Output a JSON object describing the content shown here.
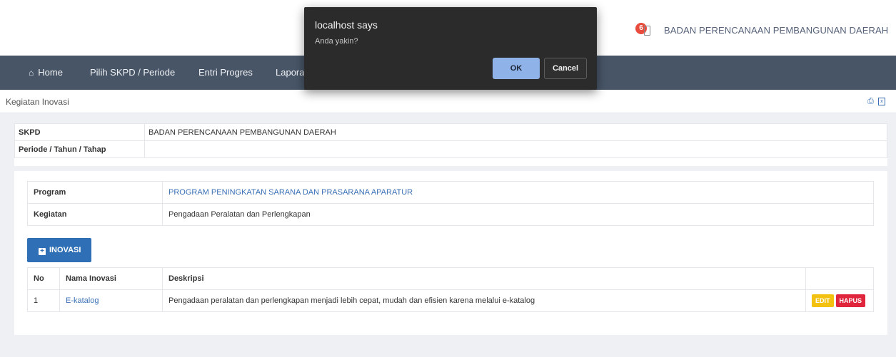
{
  "header": {
    "notification_count": "6",
    "org_name": "BADAN PERENCANAAN PEMBANGUNAN DAERAH"
  },
  "nav": {
    "home": "Home",
    "pilih": "Pilih SKPD / Periode",
    "entri": "Entri Progres",
    "laporan": "Lapora"
  },
  "subheader": {
    "title": "Kegiatan Inovasi"
  },
  "info": {
    "skpd_label": "SKPD",
    "skpd_value": "BADAN PERENCANAAN PEMBANGUNAN DAERAH",
    "periode_label": "Periode / Tahun / Tahap",
    "periode_value": ""
  },
  "program": {
    "program_label": "Program",
    "program_value": "PROGRAM PENINGKATAN SARANA DAN PRASARANA APARATUR",
    "kegiatan_label": "Kegiatan",
    "kegiatan_value": "Pengadaan Peralatan dan Perlengkapan"
  },
  "add_button": {
    "label": "INOVASI"
  },
  "table": {
    "headers": [
      "No",
      "Nama Inovasi",
      "Deskripsi",
      ""
    ],
    "rows": [
      {
        "no": "1",
        "nama": "E-katalog",
        "deskripsi": "Pengadaan peralatan dan perlengkapan menjadi lebih cepat, mudah dan efisien karena melalui e-katalog",
        "edit": "EDIT",
        "hapus": "HAPUS"
      }
    ]
  },
  "dialog": {
    "title": "localhost says",
    "message": "Anda yakin?",
    "ok": "OK",
    "cancel": "Cancel"
  },
  "colors": {
    "navbar": "#475567",
    "primary": "#2e6fb5",
    "edit": "#f3c10f",
    "hapus": "#e0263c",
    "dialog_bg": "#2b2b2b"
  }
}
